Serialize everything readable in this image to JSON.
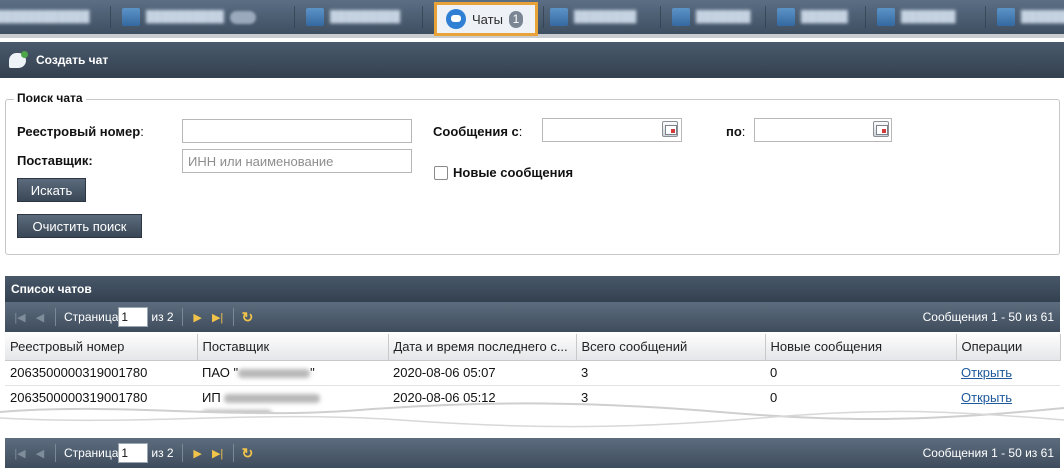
{
  "topnav": {
    "blurred_items": [
      {
        "icon": "report-icon"
      },
      {
        "icon": "notifications-icon"
      },
      {
        "icon": "statistics-icon"
      },
      {
        "icon": "services-icon"
      },
      {
        "icon": "news-icon"
      },
      {
        "icon": "print-icon"
      },
      {
        "icon": "help-icon"
      },
      {
        "icon": "exit-icon"
      }
    ],
    "active": {
      "label": "Чаты",
      "count": "1",
      "icon": "chat-icon",
      "highlight_color": "#e8a23a"
    }
  },
  "create_chat": {
    "label": "Создать чат"
  },
  "search": {
    "legend": "Поиск чата",
    "registry_label": "Реестровый номер",
    "registry_value": "",
    "supplier_label": "Поставщик",
    "supplier_value": "",
    "supplier_placeholder": "ИНН или наименование",
    "messages_from_label": "Сообщения с",
    "messages_from_value": "",
    "messages_to_label": "по",
    "messages_to_value": "",
    "new_messages_label": "Новые сообщения",
    "new_messages_checked": false,
    "search_button": "Искать",
    "clear_button": "Очистить поиск"
  },
  "chat_list": {
    "title": "Список чатов",
    "pager": {
      "page_label": "Страница",
      "page": "1",
      "of_label": "из 2",
      "status": "Сообщения 1 - 50 из 61"
    },
    "columns": [
      "Реестровый номер",
      "Поставщик",
      "Дата и время последнего с...",
      "Всего сообщений",
      "Новые сообщения",
      "Операции"
    ],
    "rows": [
      {
        "registry": "2063500000319001780",
        "supplier": "ПАО \"",
        "supplier_suffix": "\"",
        "datetime": "2020-08-06 05:07",
        "total": "3",
        "new": "0",
        "operation": "Открыть"
      },
      {
        "registry": "2063500000319001780",
        "supplier": "ИП",
        "supplier_suffix": "",
        "datetime": "2020-08-06 05:12",
        "total": "3",
        "new": "0",
        "operation": "Открыть"
      }
    ]
  },
  "colors": {
    "header_dark": "#3b4b5e",
    "link": "#1f5a9c",
    "pager_active": "#f2c34a"
  }
}
